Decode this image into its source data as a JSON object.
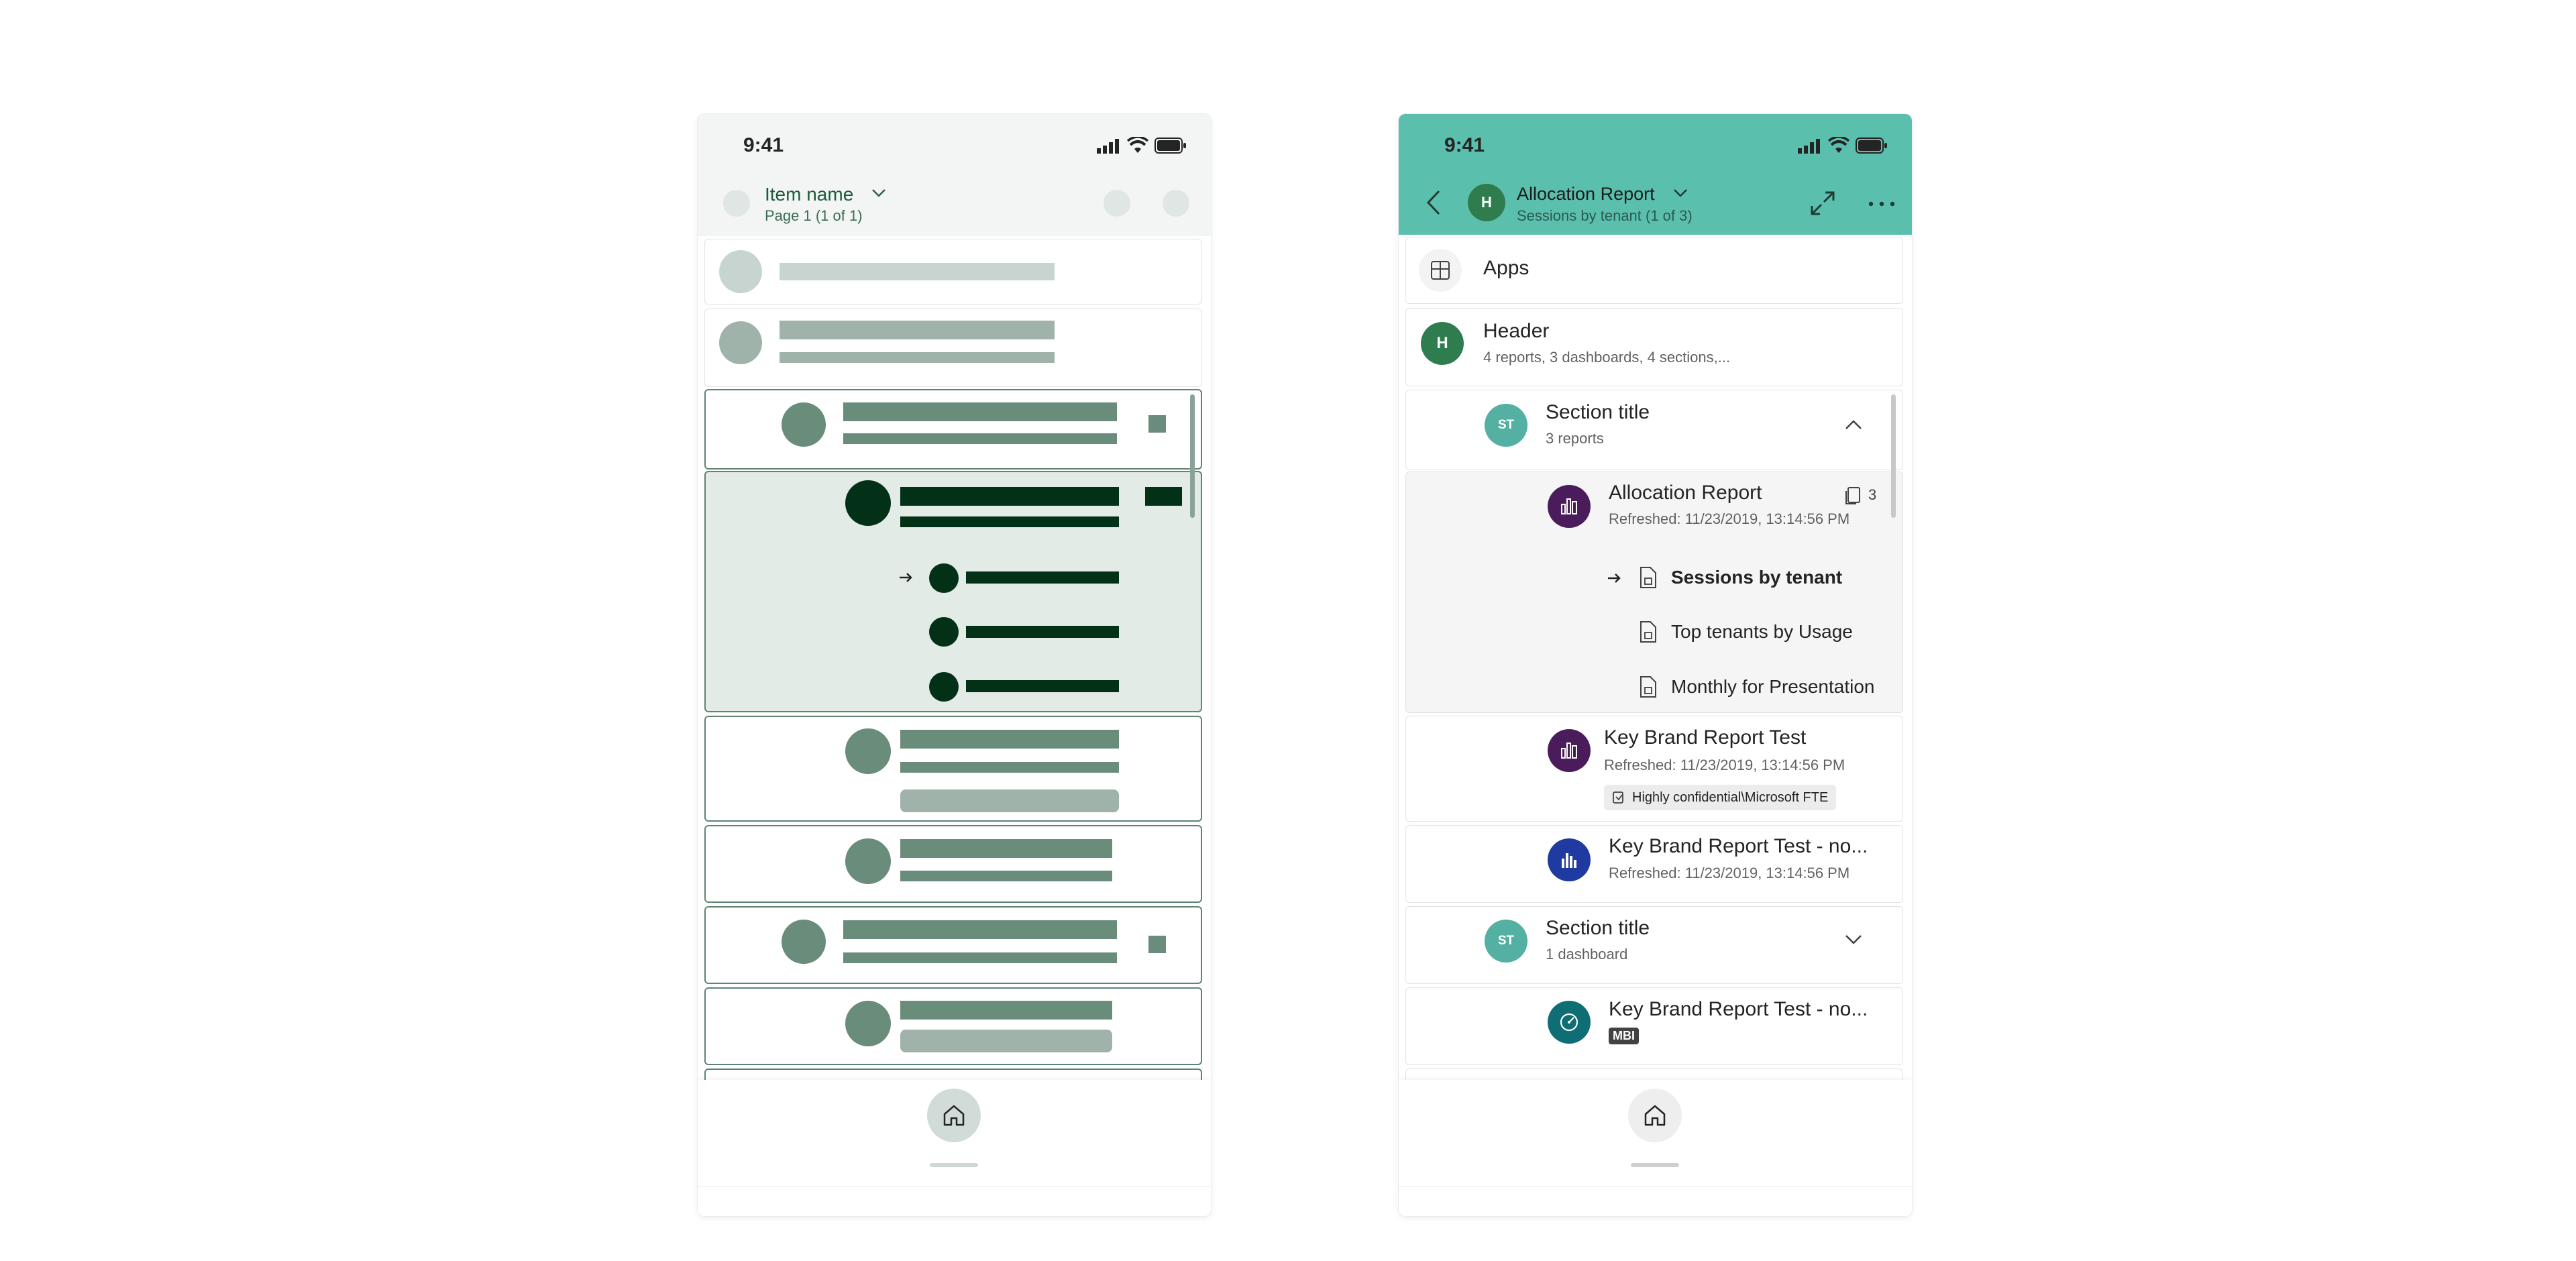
{
  "left_phone": {
    "status_time": "9:41",
    "header": {
      "item_name": "Item name",
      "page_info": "Page 1 (1 of 1)"
    }
  },
  "right_phone": {
    "status_time": "9:41",
    "header": {
      "avatar_letter": "H",
      "title": "Allocation Report",
      "subtitle": "Sessions by tenant (1 of 3)"
    },
    "list": {
      "apps_label": "Apps",
      "workspace": {
        "avatar": "H",
        "title": "Header",
        "subtitle": "4 reports, 3 dashboards, 4 sections,..."
      },
      "section1": {
        "avatar": "ST",
        "title": "Section title",
        "subtitle": "3 reports"
      },
      "report1": {
        "title": "Allocation Report",
        "subtitle": "Refreshed: 11/23/2019, 13:14:56 PM",
        "page_count": "3",
        "pages": [
          "Sessions by tenant",
          "Top tenants by Usage",
          "Monthly for Presentation"
        ]
      },
      "report2": {
        "title": "Key Brand Report Test",
        "subtitle": "Refreshed: 11/23/2019, 13:14:56 PM",
        "sensitivity": "Highly confidential\\Microsoft FTE"
      },
      "report3": {
        "title": "Key Brand Report Test - no...",
        "subtitle": "Refreshed: 11/23/2019, 13:14:56 PM"
      },
      "section2": {
        "avatar": "ST",
        "title": "Section title",
        "subtitle": "1 dashboard"
      },
      "dashboard1": {
        "title": "Key Brand Report Test - no...",
        "badge": "MBI"
      }
    }
  },
  "colors": {
    "header_teal": "#5bbfae",
    "skeleton_dark": "#033118",
    "skeleton_mid": "#6a8c7b",
    "skeleton_light": "#9fb3aa",
    "avatar_green": "#2f7d4f",
    "avatar_teal": "#53b0a3",
    "report_purple": "#4a1c5c",
    "report_blue": "#1f3aa0",
    "dashboard_teal": "#0f6d74"
  },
  "icons": [
    "signal-icon",
    "wifi-icon",
    "battery-icon",
    "chevron-down-icon",
    "back-icon",
    "expand-icon",
    "more-icon",
    "apps-icon",
    "chevron-up-icon",
    "report-icon",
    "page-icon",
    "arrow-right-icon",
    "home-icon",
    "gauge-icon",
    "sensitivity-icon"
  ]
}
